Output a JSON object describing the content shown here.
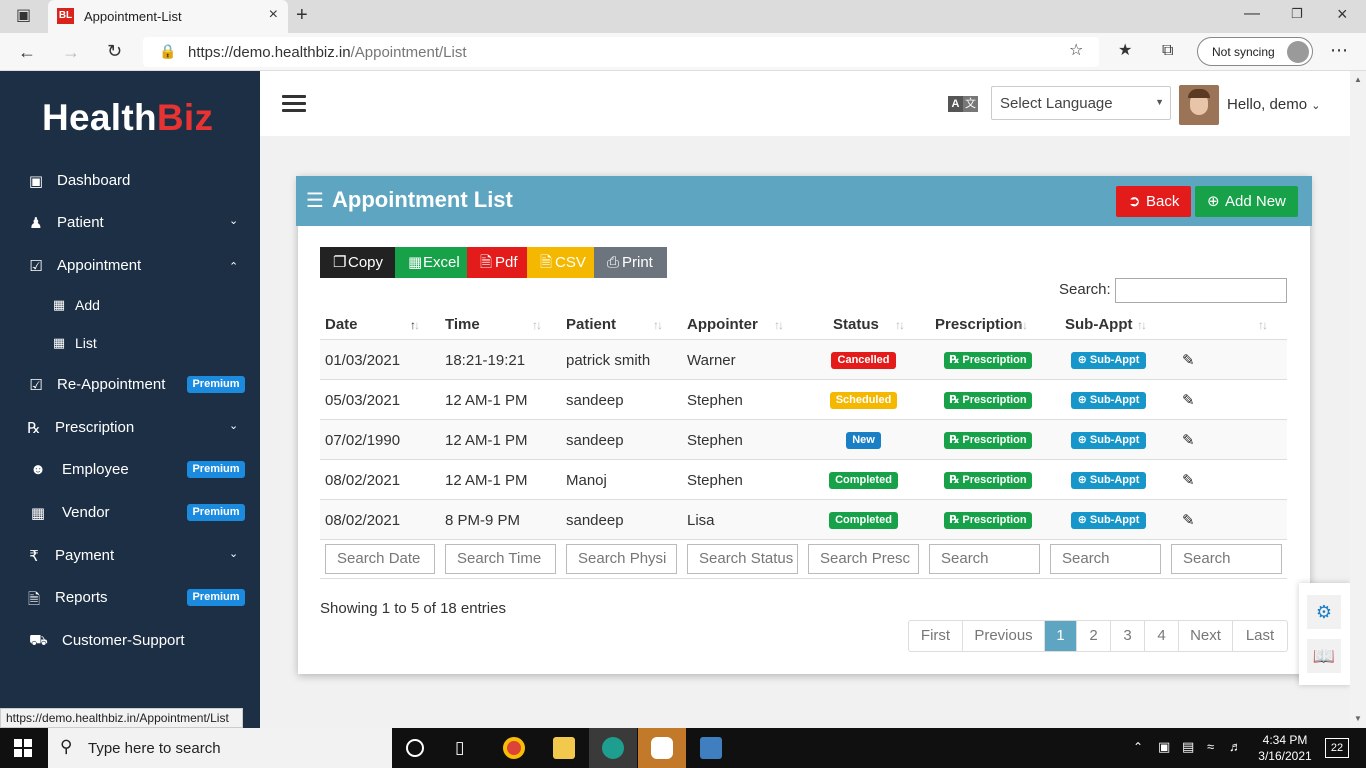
{
  "browser": {
    "tab_title": "Appointment-List",
    "tab_favicon": "BL",
    "url_host": "https://demo.healthbiz.in",
    "url_path": "/Appointment/List",
    "sync_label": "Not syncing",
    "status_url": "https://demo.healthbiz.in/Appointment/List"
  },
  "logo": {
    "part1": "Health",
    "part2": "Biz"
  },
  "sidebar": {
    "items": [
      {
        "label": "Dashboard",
        "icon": "dashboard-icon"
      },
      {
        "label": "Patient",
        "icon": "patient-icon",
        "chevron": "chevron-down"
      },
      {
        "label": "Appointment",
        "icon": "calendar-check-icon",
        "chevron": "chevron-up"
      },
      {
        "label": "Add",
        "icon": "calendar-plus-icon"
      },
      {
        "label": "List",
        "icon": "calendar-list-icon"
      },
      {
        "label": "Re-Appointment",
        "icon": "calendar-check-icon",
        "badge": "Premium"
      },
      {
        "label": "Prescription",
        "icon": "prescription-icon",
        "chevron": "chevron-down"
      },
      {
        "label": "Employee",
        "icon": "users-icon",
        "badge": "Premium"
      },
      {
        "label": "Vendor",
        "icon": "building-icon",
        "badge": "Premium"
      },
      {
        "label": "Payment",
        "icon": "rupee-icon",
        "chevron": "chevron-down"
      },
      {
        "label": "Reports",
        "icon": "file-icon",
        "badge": "Premium"
      },
      {
        "label": "Customer-Support",
        "icon": "ambulance-icon"
      }
    ]
  },
  "topbar": {
    "language_placeholder": "Select Language",
    "greeting": "Hello, demo"
  },
  "card": {
    "title": "Appointment List",
    "back_label": "Back",
    "add_new_label": "Add New",
    "export_buttons": [
      {
        "label": "Copy",
        "color": "#222222"
      },
      {
        "label": "Excel",
        "color": "#17a24a"
      },
      {
        "label": "Pdf",
        "color": "#e31b1b"
      },
      {
        "label": "CSV",
        "color": "#f5b800"
      },
      {
        "label": "Print",
        "color": "#6c757d"
      }
    ],
    "search_label": "Search:",
    "columns": [
      "Date",
      "Time",
      "Patient",
      "Appointer",
      "Status",
      "Prescription",
      "Sub-Appt"
    ],
    "rows": [
      {
        "date": "01/03/2021",
        "time": "18:21-19:21",
        "patient": "patrick smith",
        "appointer": "Warner",
        "status": "Cancelled",
        "status_color": "#e31b1b"
      },
      {
        "date": "05/03/2021",
        "time": "12 AM-1 PM",
        "patient": "sandeep",
        "appointer": "Stephen",
        "status": "Scheduled",
        "status_color": "#f5b800"
      },
      {
        "date": "07/02/1990",
        "time": "12 AM-1 PM",
        "patient": "sandeep",
        "appointer": "Stephen",
        "status": "New",
        "status_color": "#1b7fc6"
      },
      {
        "date": "08/02/2021",
        "time": "12 AM-1 PM",
        "patient": "Manoj",
        "appointer": "Stephen",
        "status": "Completed",
        "status_color": "#17a24a"
      },
      {
        "date": "08/02/2021",
        "time": "8 PM-9 PM",
        "patient": "sandeep",
        "appointer": "Lisa",
        "status": "Completed",
        "status_color": "#17a24a"
      }
    ],
    "prescription_btn": "Prescription",
    "subappt_btn": "Sub-Appt",
    "filter_placeholders": [
      "Search Date",
      "Search Time",
      "Search Physi",
      "Search Status",
      "Search Presc",
      "Search",
      "Search",
      "Search"
    ],
    "info": "Showing 1 to 5 of 18 entries",
    "pager": [
      "First",
      "Previous",
      "1",
      "2",
      "3",
      "4",
      "Next",
      "Last"
    ]
  },
  "taskbar": {
    "search_placeholder": "Type here to search",
    "time": "4:34 PM",
    "date": "3/16/2021",
    "notification_count": "22"
  }
}
